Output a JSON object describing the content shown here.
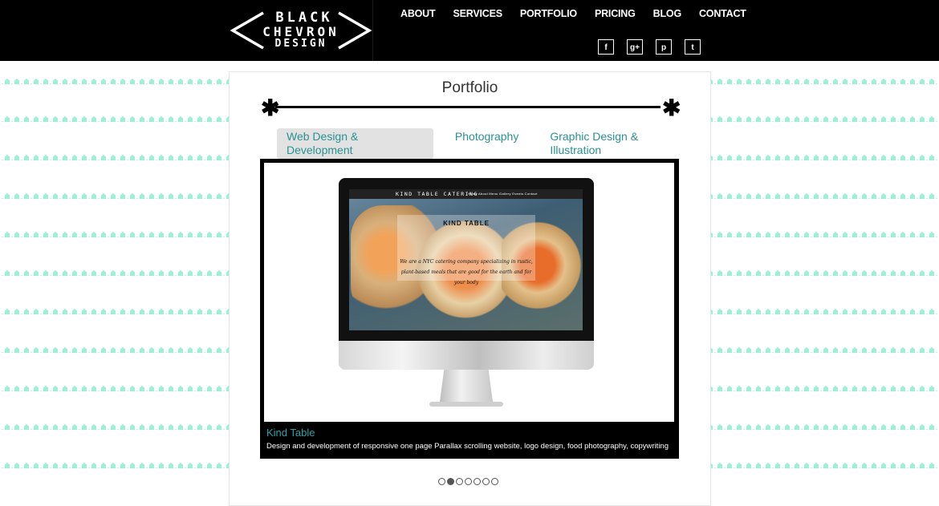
{
  "brand": {
    "line1": "BLACK",
    "line2": "CHEVRON",
    "line3": "DESIGN"
  },
  "nav": [
    "ABOUT",
    "SERVICES",
    "PORTFOLIO",
    "PRICING",
    "BLOG",
    "CONTACT"
  ],
  "social": [
    {
      "icon": "facebook-icon",
      "glyph": "f"
    },
    {
      "icon": "google-plus-icon",
      "glyph": "g+"
    },
    {
      "icon": "pinterest-icon",
      "glyph": "p"
    },
    {
      "icon": "twitter-icon",
      "glyph": "t"
    }
  ],
  "page": {
    "title": "Portfolio"
  },
  "tabs": [
    {
      "label": "Web Design & Development",
      "active": true
    },
    {
      "label": "Photography",
      "active": false
    },
    {
      "label": "Graphic Design & Illustration",
      "active": false
    }
  ],
  "slide": {
    "site_title": "KIND TABLE CATERING",
    "site_links": "Home  About  Menu  Gallery  Events  Contact",
    "logo_text": "KIND TABLE",
    "tagline": "We are a NYC catering company specializing in rustic, plant-based meals that are good for the earth and for your body",
    "name": "Kind Table",
    "description": "Design and development of responsive one page Parallax scrolling website, logo design, food photography, copywriting"
  },
  "pagination": {
    "count": 7,
    "active_index": 1
  },
  "colors": {
    "accent": "#2a9192",
    "pattern": "#9cf0d6",
    "header": "#000000"
  }
}
